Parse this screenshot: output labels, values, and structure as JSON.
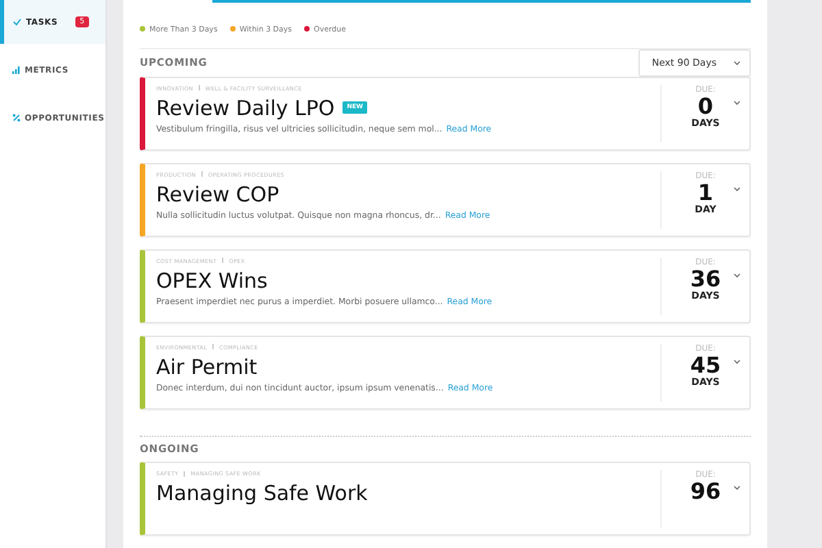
{
  "sidebar": {
    "items": [
      {
        "kind": "tasks",
        "label": "TASKS",
        "badge": "5",
        "selected": true
      },
      {
        "kind": "metrics",
        "label": "METRICS",
        "selected": false
      },
      {
        "kind": "opportunities",
        "label": "OPPORTUNITIES",
        "selected": false
      }
    ]
  },
  "legend": [
    {
      "label": "More Than 3 Days",
      "color": "#a8c43a"
    },
    {
      "label": "Within 3 Days",
      "color": "#f5a623"
    },
    {
      "label": "Overdue",
      "color": "#d9183b"
    }
  ],
  "sections": [
    {
      "title": "UPCOMING",
      "filter": "Next 90 Days",
      "cards": [
        {
          "breadcrumb": [
            "INNOVATION",
            "WELL & FACILITY SURVEILLANCE"
          ],
          "title": "Review Daily LPO",
          "badge": "NEW",
          "description": "Vestibulum fringilla, risus vel ultricies sollicitudin, neque sem mol...",
          "link": "Read More",
          "due_label": "DUE:",
          "due_value": "0",
          "due_unit": "DAYS",
          "color": "#d9183b"
        },
        {
          "breadcrumb": [
            "PRODUCTION",
            "OPERATING PROCEDURES"
          ],
          "title": "Review COP",
          "description": "Nulla sollicitudin luctus volutpat. Quisque non magna rhoncus, dr...",
          "link": "Read More",
          "due_label": "DUE:",
          "due_value": "1",
          "due_unit": "DAY",
          "color": "#f5a623"
        },
        {
          "breadcrumb": [
            "COST MANAGEMENT",
            "OPEX"
          ],
          "title": "OPEX Wins",
          "description": "Praesent imperdiet nec purus a imperdiet. Morbi posuere ullamco...",
          "link": "Read More",
          "due_label": "DUE:",
          "due_value": "36",
          "due_unit": "DAYS",
          "color": "#a8c43a"
        },
        {
          "breadcrumb": [
            "ENVIRONMENTAL",
            "COMPLIANCE"
          ],
          "title": "Air Permit",
          "description": "Donec interdum, dui non tincidunt auctor, ipsum ipsum venenatis...",
          "link": "Read More",
          "due_label": "DUE:",
          "due_value": "45",
          "due_unit": "DAYS",
          "color": "#a8c43a"
        }
      ]
    },
    {
      "title": "ONGOING",
      "cards": [
        {
          "breadcrumb": [
            "SAFETY",
            "MANAGING SAFE WORK"
          ],
          "title": "Managing Safe Work",
          "due_label": "DUE:",
          "due_value": "96",
          "color": "#a8c43a"
        }
      ]
    }
  ]
}
